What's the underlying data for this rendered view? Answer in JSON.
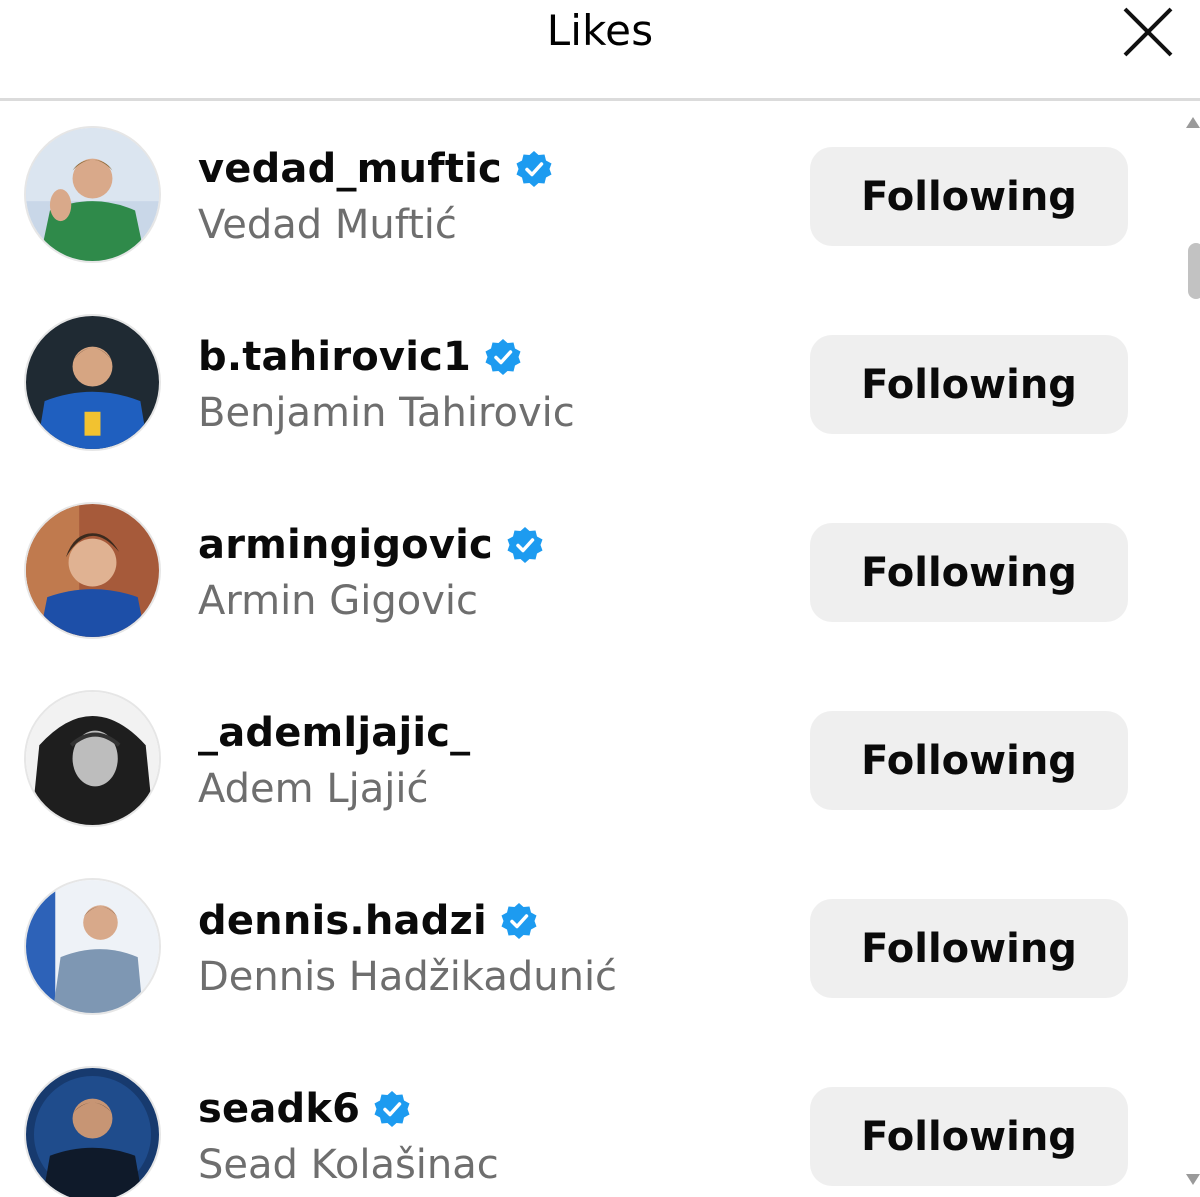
{
  "header": {
    "title": "Likes"
  },
  "icons": {
    "close": "close-icon",
    "verified": "verified-badge-icon"
  },
  "colors": {
    "verified": "#1d9bf0",
    "follow_button_bg": "#efefef",
    "secondary_text": "#6e6e6e"
  },
  "users": [
    {
      "username": "vedad_muftic",
      "full_name": "Vedad Muftić",
      "verified": true,
      "button": "Following"
    },
    {
      "username": "b.tahirovic1",
      "full_name": "Benjamin Tahirovic",
      "verified": true,
      "button": "Following"
    },
    {
      "username": "armingigovic",
      "full_name": "Armin Gigovic",
      "verified": true,
      "button": "Following"
    },
    {
      "username": "_ademljajic_",
      "full_name": "Adem Ljajić",
      "verified": false,
      "button": "Following"
    },
    {
      "username": "dennis.hadzi",
      "full_name": "Dennis Hadžikadunić",
      "verified": true,
      "button": "Following"
    },
    {
      "username": "seadk6",
      "full_name": "Sead Kolašinac",
      "verified": true,
      "button": "Following"
    }
  ]
}
